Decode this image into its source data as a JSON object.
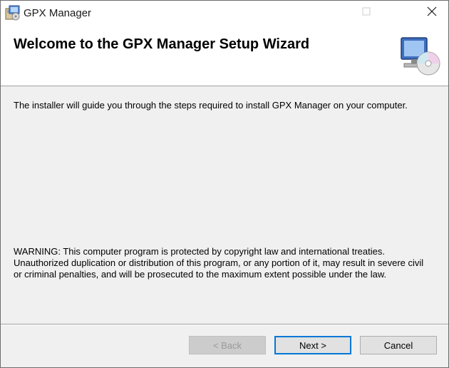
{
  "window": {
    "title": "GPX Manager",
    "controls": {
      "minimize_icon": "minimize-icon",
      "maximize_icon": "maximize-icon",
      "close_icon": "close-icon"
    }
  },
  "header": {
    "title": "Welcome to the GPX Manager Setup Wizard",
    "icon": "computer-cd-icon"
  },
  "body": {
    "intro": "The installer will guide you through the steps required to install GPX Manager on your computer.",
    "warning": "WARNING: This computer program is protected by copyright law and international treaties. Unauthorized duplication or distribution of this program, or any portion of it, may result in severe civil or criminal penalties, and will be prosecuted to the maximum extent possible under the law."
  },
  "buttons": {
    "back": "< Back",
    "next": "Next >",
    "cancel": "Cancel"
  },
  "colors": {
    "accent": "#0078d7",
    "dialog_bg": "#f0f0f0",
    "header_bg": "#ffffff"
  }
}
